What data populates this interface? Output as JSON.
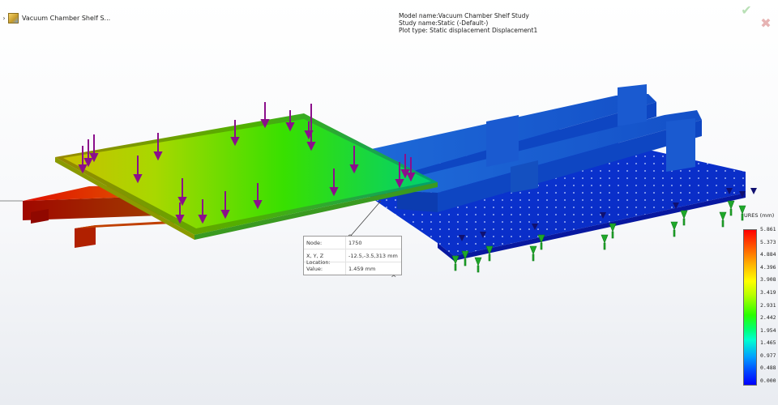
{
  "tree": {
    "expand_glyph": "›",
    "part_name": "Vacuum Chamber Shelf S..."
  },
  "actions": {
    "ok_glyph": "✔",
    "cancel_glyph": "✖"
  },
  "study": {
    "model_line": "Model name:Vacuum Chamber Shelf Study",
    "study_line": "Study name:Static (-Default-)",
    "plot_line": "Plot type:  Static displacement Displacement1"
  },
  "probe": {
    "node_label": "Node:",
    "node_value": "1750",
    "location_label": "X, Y, Z Location:",
    "location_value": "-12.5,-3.5,313 mm",
    "value_label": "Value:",
    "value_value": "1.459     mm",
    "collapse_glyph": "^"
  },
  "legend": {
    "title": "URES (mm)",
    "labels": [
      "5.861",
      "5.373",
      "4.884",
      "4.396",
      "3.908",
      "3.419",
      "2.931",
      "2.442",
      "1.954",
      "1.465",
      "0.977",
      "0.488",
      "0.000"
    ]
  },
  "colors": {
    "max": "#ff0000",
    "mid": "#28ff00",
    "min": "#0000ff",
    "load_arrow": "#8b0f8b",
    "fixture": "#1fa82a"
  }
}
